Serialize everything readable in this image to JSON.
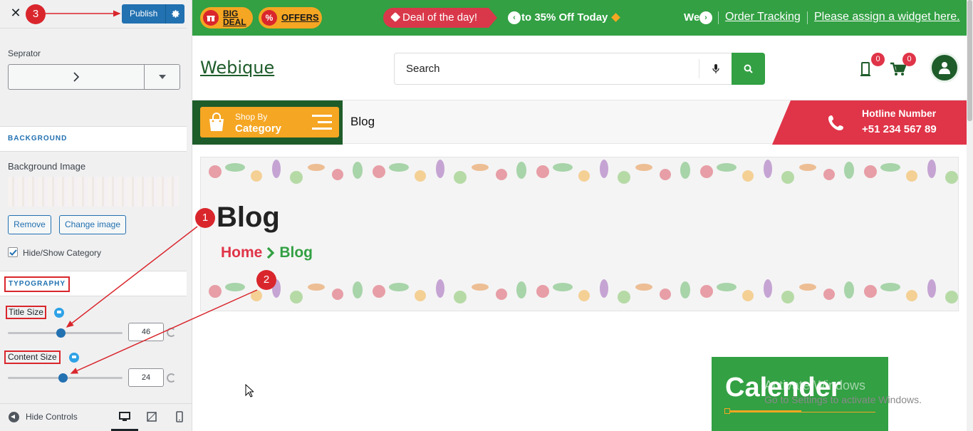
{
  "customizer": {
    "close_label": "✕",
    "publish_label": "Publish",
    "separator_label": "Seprator",
    "separator_value": ">",
    "background_section": "BACKGROUND",
    "background_image_label": "Background Image",
    "remove_label": "Remove",
    "change_image_label": "Change image",
    "hide_show_category_label": "Hide/Show Category",
    "hide_show_category_checked": true,
    "typography_section": "TYPOGRAPHY",
    "title_size_label": "Title Size",
    "title_size_value": "46",
    "title_size_level": 0.46,
    "content_size_label": "Content Size",
    "content_size_value": "24",
    "content_size_level": 0.48,
    "hide_controls_label": "Hide Controls",
    "accent_color": "#2271b1"
  },
  "annotations": {
    "n1": "1",
    "n2": "2",
    "n3": "3",
    "color": "#d9262c"
  },
  "site": {
    "topbar": {
      "big_deal": "BIG DEAL",
      "big_deal_line1": "BIG",
      "big_deal_line2": "DEAL",
      "offers": "OFFERS",
      "deal_of_day": "Deal of the day!",
      "ticker": "to 35% Off Today",
      "ticker_next": "We",
      "order_tracking": "Order Tracking",
      "widget_link": "Please assign a widget here.",
      "color": "#32a043"
    },
    "logo": "Webique",
    "search_placeholder": "Search",
    "wishlist_count": "0",
    "cart_count": "0",
    "category_small": "Shop By",
    "category_big": "Category",
    "nav_blog": "Blog",
    "hotline_title": "Hotline Number",
    "hotline_number": "+51 234 567 89",
    "banner_title": "Blog",
    "breadcrumb_home": "Home",
    "breadcrumb_current": "Blog",
    "calendar_title": "Calender"
  },
  "watermark": {
    "line1": "Activate Windows",
    "line2": "Go to Settings to activate Windows."
  }
}
